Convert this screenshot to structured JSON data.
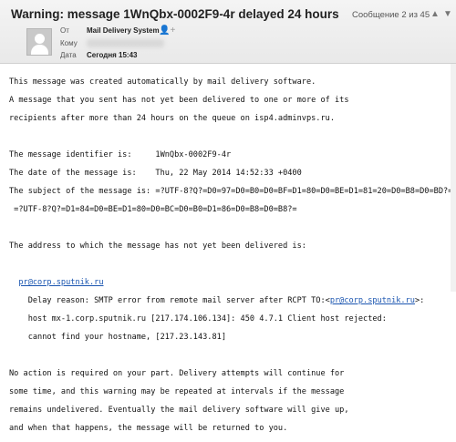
{
  "header": {
    "subject": "Warning: message 1WnQbx-0002F9-4r delayed 24 hours",
    "counter": "Сообщение 2 из 45",
    "prev_glyph": "▲",
    "next_glyph": "▼",
    "from_label": "От",
    "from_value": "Mail Delivery System",
    "to_label": "Кому",
    "date_label": "Дата",
    "date_value": "Сегодня 15:43",
    "add_contact_icon": "person-add-icon",
    "add_contact_glyph": "👤+"
  },
  "body": {
    "p1": [
      "This message was created automatically by mail delivery software.",
      "A message that you sent has not yet been delivered to one or more of its",
      "recipients after more than 24 hours on the queue on isp4.adminvps.ru."
    ],
    "p2": [
      "The message identifier is:     1WnQbx-0002F9-4r",
      "The date of the message is:    Thu, 22 May 2014 14:52:33 +0400",
      "The subject of the message is: =?UTF-8?Q?=D0=97=D0=B0=D0=BF=D1=80=D0=BE=D1=81=20=D0=B8=D0=BD?=",
      " =?UTF-8?Q?=D1=84=D0=BE=D1=80=D0=BC=D0=B0=D1=86=D0=B8=D0=B8?="
    ],
    "p3": "The address to which the message has not yet been delivered is:",
    "address_link": "pr@corp.sputnik.ru",
    "delay_prefix": "    Delay reason: SMTP error from remote mail server after RCPT TO:<",
    "delay_suffix": ">:",
    "delay_lines": [
      "    host mx-1.corp.sputnik.ru [217.174.106.134]: 450 4.7.1 Client host rejected:",
      "    cannot find your hostname, [217.23.143.81]"
    ],
    "p4": [
      "No action is required on your part. Delivery attempts will continue for",
      "some time, and this warning may be repeated at intervals if the message",
      "remains undelivered. Eventually the mail delivery software will give up,",
      "and when that happens, the message will be returned to you."
    ]
  }
}
